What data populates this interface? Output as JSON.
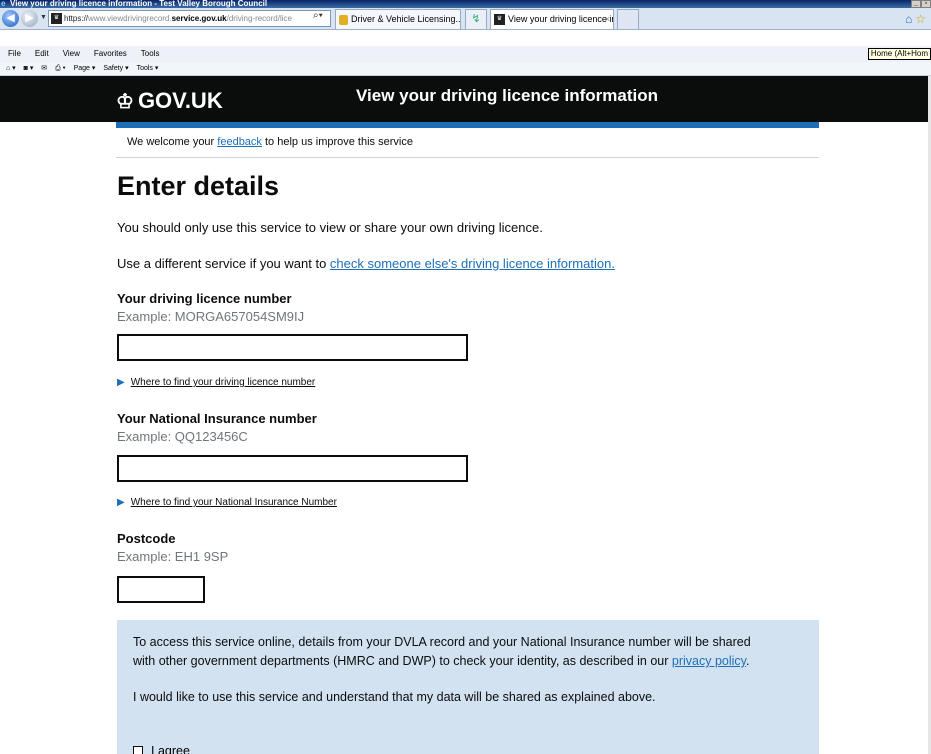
{
  "browser": {
    "window_title": "View your driving licence information - Test Valley Borough Council",
    "window_buttons": [
      "_",
      "▫"
    ],
    "address": {
      "protocol": "https://",
      "host": "www.viewdrivingrecord.",
      "domain": "service.gov.uk",
      "path": "/driving-record/lice"
    },
    "tabs": [
      {
        "label": "Driver & Vehicle Licensing..."
      },
      {
        "label": "View your driving licence info..."
      }
    ],
    "menu": [
      "File",
      "Edit",
      "View",
      "Favorites",
      "Tools"
    ],
    "tooltip": "Home (Alt+Hom",
    "command_bar": [
      "Page ▾",
      "Safety ▾",
      "Tools ▾"
    ]
  },
  "header": {
    "logo_text": "GOV.UK",
    "service_name": "View your driving licence information"
  },
  "feedback": {
    "before": "We welcome your ",
    "link": "feedback",
    "after": " to help us improve this service"
  },
  "page": {
    "title": "Enter details",
    "intro": "You should only use this service to view or share your own driving licence.",
    "other_service_text": "Use a different service if you want to ",
    "other_service_link": "check someone else's driving licence information."
  },
  "form": {
    "licence": {
      "label": "Your driving licence number",
      "hint": "Example: MORGA657054SM9IJ",
      "value": "",
      "help_link": "Where to find your driving licence number"
    },
    "ni": {
      "label": "Your National Insurance number",
      "hint": "Example: QQ123456C",
      "value": "",
      "help_link": "Where to find your National Insurance Number"
    },
    "postcode": {
      "label": "Postcode",
      "hint": "Example: EH1 9SP",
      "value": ""
    }
  },
  "consent": {
    "line1": "To access this service online, details from your DVLA record and your National Insurance number will be shared",
    "line2_before": "with other government departments (HMRC and DWP) to check your identity, as described in our ",
    "line2_link": "privacy policy",
    "line2_after": ".",
    "statement": "I would like to use this service and understand that my data will be shared as explained above.",
    "checkbox_label": "I agree",
    "checked": false
  }
}
